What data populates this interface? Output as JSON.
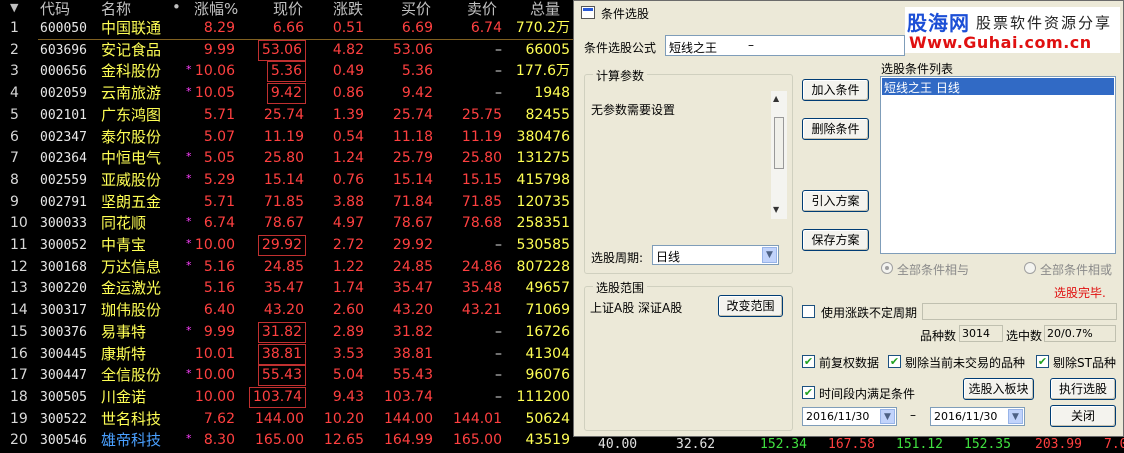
{
  "table": {
    "headers": {
      "code": "代码",
      "name": "名称",
      "dot": "•",
      "chg": "涨幅%",
      "price": "现价",
      "diff": "涨跌",
      "buy": "买价",
      "sell": "卖价",
      "vol": "总量",
      "sort_arrow": "▼"
    },
    "rows": [
      {
        "idx": "1",
        "code": "600050",
        "name": "中国联通",
        "star": "",
        "chg": "8.29",
        "price": "6.66",
        "diff": "0.51",
        "buy": "6.69",
        "sell": "6.74",
        "vol": "770.2万"
      },
      {
        "idx": "2",
        "code": "603696",
        "name": "安记食品",
        "star": "",
        "chg": "9.99",
        "price": "53.06",
        "diff": "4.82",
        "buy": "53.06",
        "sell": "–",
        "vol": "66005"
      },
      {
        "idx": "3",
        "code": "000656",
        "name": "金科股份",
        "star": "*",
        "chg": "10.06",
        "price": "5.36",
        "diff": "0.49",
        "buy": "5.36",
        "sell": "–",
        "vol": "177.6万"
      },
      {
        "idx": "4",
        "code": "002059",
        "name": "云南旅游",
        "star": "*",
        "chg": "10.05",
        "price": "9.42",
        "diff": "0.86",
        "buy": "9.42",
        "sell": "–",
        "vol": "1948"
      },
      {
        "idx": "5",
        "code": "002101",
        "name": "广东鸿图",
        "star": "",
        "chg": "5.71",
        "price": "25.74",
        "diff": "1.39",
        "buy": "25.74",
        "sell": "25.75",
        "vol": "82455"
      },
      {
        "idx": "6",
        "code": "002347",
        "name": "泰尔股份",
        "star": "",
        "chg": "5.07",
        "price": "11.19",
        "diff": "0.54",
        "buy": "11.18",
        "sell": "11.19",
        "vol": "380476"
      },
      {
        "idx": "7",
        "code": "002364",
        "name": "中恒电气",
        "star": "*",
        "chg": "5.05",
        "price": "25.80",
        "diff": "1.24",
        "buy": "25.79",
        "sell": "25.80",
        "vol": "131275"
      },
      {
        "idx": "8",
        "code": "002559",
        "name": "亚威股份",
        "star": "*",
        "chg": "5.29",
        "price": "15.14",
        "diff": "0.76",
        "buy": "15.14",
        "sell": "15.15",
        "vol": "415798"
      },
      {
        "idx": "9",
        "code": "002791",
        "name": "坚朗五金",
        "star": "",
        "chg": "5.71",
        "price": "71.85",
        "diff": "3.88",
        "buy": "71.84",
        "sell": "71.85",
        "vol": "120735"
      },
      {
        "idx": "10",
        "code": "300033",
        "name": "同花顺",
        "star": "*",
        "chg": "6.74",
        "price": "78.67",
        "diff": "4.97",
        "buy": "78.67",
        "sell": "78.68",
        "vol": "258351"
      },
      {
        "idx": "11",
        "code": "300052",
        "name": "中青宝",
        "star": "*",
        "chg": "10.00",
        "price": "29.92",
        "diff": "2.72",
        "buy": "29.92",
        "sell": "–",
        "vol": "530585"
      },
      {
        "idx": "12",
        "code": "300168",
        "name": "万达信息",
        "star": "*",
        "chg": "5.16",
        "price": "24.85",
        "diff": "1.22",
        "buy": "24.85",
        "sell": "24.86",
        "vol": "807228"
      },
      {
        "idx": "13",
        "code": "300220",
        "name": "金运激光",
        "star": "",
        "chg": "5.16",
        "price": "35.47",
        "diff": "1.74",
        "buy": "35.47",
        "sell": "35.48",
        "vol": "49657"
      },
      {
        "idx": "14",
        "code": "300317",
        "name": "珈伟股份",
        "star": "",
        "chg": "6.40",
        "price": "43.20",
        "diff": "2.60",
        "buy": "43.20",
        "sell": "43.21",
        "vol": "71069"
      },
      {
        "idx": "15",
        "code": "300376",
        "name": "易事特",
        "star": "*",
        "chg": "9.99",
        "price": "31.82",
        "diff": "2.89",
        "buy": "31.82",
        "sell": "–",
        "vol": "16726"
      },
      {
        "idx": "16",
        "code": "300445",
        "name": "康斯特",
        "star": "",
        "chg": "10.01",
        "price": "38.81",
        "diff": "3.53",
        "buy": "38.81",
        "sell": "–",
        "vol": "41304"
      },
      {
        "idx": "17",
        "code": "300447",
        "name": "全信股份",
        "star": "*",
        "chg": "10.00",
        "price": "55.43",
        "diff": "5.04",
        "buy": "55.43",
        "sell": "–",
        "vol": "96076"
      },
      {
        "idx": "18",
        "code": "300505",
        "name": "川金诺",
        "star": "",
        "chg": "10.00",
        "price": "103.74",
        "diff": "9.43",
        "buy": "103.74",
        "sell": "–",
        "vol": "111200"
      },
      {
        "idx": "19",
        "code": "300522",
        "name": "世名科技",
        "star": "",
        "chg": "7.62",
        "price": "144.00",
        "diff": "10.20",
        "buy": "144.00",
        "sell": "144.01",
        "vol": "50624"
      },
      {
        "idx": "20",
        "code": "300546",
        "name": "雄帝科技",
        "star": "*",
        "chg": "8.30",
        "price": "165.00",
        "diff": "12.65",
        "buy": "164.99",
        "sell": "165.00",
        "vol": "43519"
      }
    ],
    "boxed_rows": [
      2,
      3,
      4,
      11,
      15,
      16,
      17,
      18
    ],
    "bottom_strip": [
      "40.00",
      "32.62",
      "152.34",
      "167.58",
      "151.12",
      "152.35",
      "203.99",
      "7.0"
    ]
  },
  "dialog": {
    "title": "条件选股",
    "logo": {
      "brand": "股海网",
      "tag": "股票软件资源分享",
      "url": "Www.Guhai.com.cn"
    },
    "formula_label": "条件选股公式",
    "formula_value": "短线之王",
    "formula_dash": "–",
    "params_group": "计算参数",
    "params_text": "无参数需要设置",
    "period_label": "选股周期:",
    "period_value": "日线",
    "buttons": {
      "add": "加入条件",
      "delete": "删除条件",
      "import": "引入方案",
      "save": "保存方案",
      "change_range": "改变范围",
      "to_block": "选股入板块",
      "execute": "执行选股",
      "close": "关闭"
    },
    "cond_list_label": "选股条件列表",
    "cond_list_item": "短线之王   日线",
    "radio_and": "全部条件相与",
    "radio_or": "全部条件相或",
    "status": "选股完毕.",
    "range_group": "选股范围",
    "range_text": "上证A股 深证A股",
    "use_period_label": "使用涨跌不定周期",
    "count_label": "品种数",
    "count_value": "3014",
    "selected_label": "选中数",
    "selected_value": "20/0.7%",
    "chk_adjust": "前复权数据",
    "chk_exclude_untraded": "剔除当前未交易的品种",
    "chk_exclude_st": "剔除ST品种",
    "chk_time_range": "时间段内满足条件",
    "date_from": "2016/11/30",
    "date_sep": "–",
    "date_to": "2016/11/30"
  }
}
